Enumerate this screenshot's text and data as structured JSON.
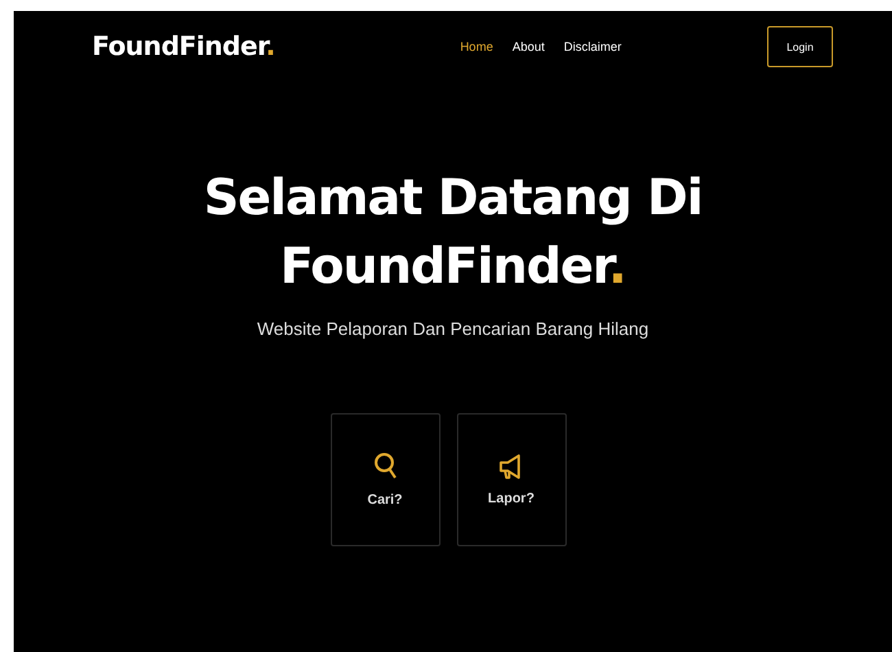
{
  "navbar": {
    "logo": {
      "name": "FoundFinder",
      "mark": "."
    },
    "links": [
      {
        "label": "Home",
        "selected": true
      },
      {
        "label": "About",
        "selected": false
      },
      {
        "label": "Disclaimer",
        "selected": false
      }
    ],
    "login_button": "Login"
  },
  "hero": {
    "title_line_1": "Selamat Datang Di",
    "title_line_2": "FoundFinder",
    "title_mark": ".",
    "subtitle": "Website Pelaporan Dan Pencarian Barang Hilang"
  },
  "actions": [
    {
      "kind": "search",
      "label": "Cari?"
    },
    {
      "kind": "report",
      "label": "Lapor?"
    }
  ]
}
